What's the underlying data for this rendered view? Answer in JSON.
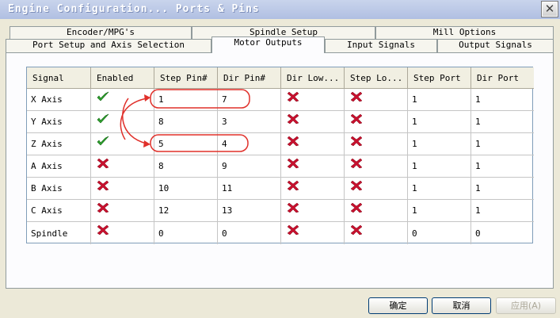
{
  "window": {
    "title": "Engine Configuration... Ports & Pins",
    "close_glyph": "✕"
  },
  "tabs": {
    "back": [
      {
        "label": "Encoder/MPG's"
      },
      {
        "label": "Spindle Setup"
      },
      {
        "label": "Mill Options"
      }
    ],
    "front": [
      {
        "label": "Port Setup and Axis Selection"
      },
      {
        "label": "Motor Outputs"
      },
      {
        "label": "Input Signals"
      },
      {
        "label": "Output Signals"
      }
    ]
  },
  "table": {
    "headers": [
      "Signal",
      "Enabled",
      "Step Pin#",
      "Dir Pin#",
      "Dir Low...",
      "Step Lo...",
      "Step Port",
      "Dir Port"
    ],
    "rows": [
      {
        "signal": "X Axis",
        "enabled": true,
        "step_pin": "1",
        "dir_pin": "7",
        "dir_low": false,
        "step_low": false,
        "step_port": "1",
        "dir_port": "1"
      },
      {
        "signal": "Y Axis",
        "enabled": true,
        "step_pin": "8",
        "dir_pin": "3",
        "dir_low": false,
        "step_low": false,
        "step_port": "1",
        "dir_port": "1"
      },
      {
        "signal": "Z Axis",
        "enabled": true,
        "step_pin": "5",
        "dir_pin": "4",
        "dir_low": false,
        "step_low": false,
        "step_port": "1",
        "dir_port": "1"
      },
      {
        "signal": "A Axis",
        "enabled": false,
        "step_pin": "8",
        "dir_pin": "9",
        "dir_low": false,
        "step_low": false,
        "step_port": "1",
        "dir_port": "1"
      },
      {
        "signal": "B Axis",
        "enabled": false,
        "step_pin": "10",
        "dir_pin": "11",
        "dir_low": false,
        "step_low": false,
        "step_port": "1",
        "dir_port": "1"
      },
      {
        "signal": "C Axis",
        "enabled": false,
        "step_pin": "12",
        "dir_pin": "13",
        "dir_low": false,
        "step_low": false,
        "step_port": "1",
        "dir_port": "1"
      },
      {
        "signal": "Spindle",
        "enabled": false,
        "step_pin": "0",
        "dir_pin": "0",
        "dir_low": false,
        "step_low": false,
        "step_port": "0",
        "dir_port": "0"
      }
    ]
  },
  "icons": {
    "enabled_true": "green-check-icon",
    "enabled_false": "red-x-icon"
  },
  "colors": {
    "check": "#2fa52f",
    "cross": "#c8102e",
    "annotation": "#e0302a"
  },
  "buttons": {
    "ok": "确定",
    "cancel": "取消",
    "apply": "应用(A)"
  }
}
